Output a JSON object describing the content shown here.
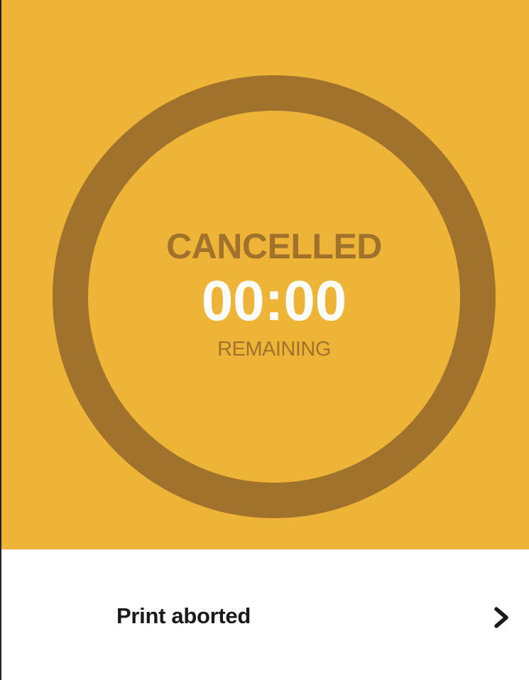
{
  "print_status": {
    "state": "CANCELLED",
    "time_remaining": "00:00",
    "time_caption": "REMAINING",
    "progress": 0
  },
  "details_row": {
    "label": "Print aborted",
    "icon": "chevron-right-icon"
  },
  "colors": {
    "panel_background": "#EDB438",
    "ring": "#A0722B",
    "time_text": "#ffffff",
    "row_text": "#1a1a1a"
  }
}
